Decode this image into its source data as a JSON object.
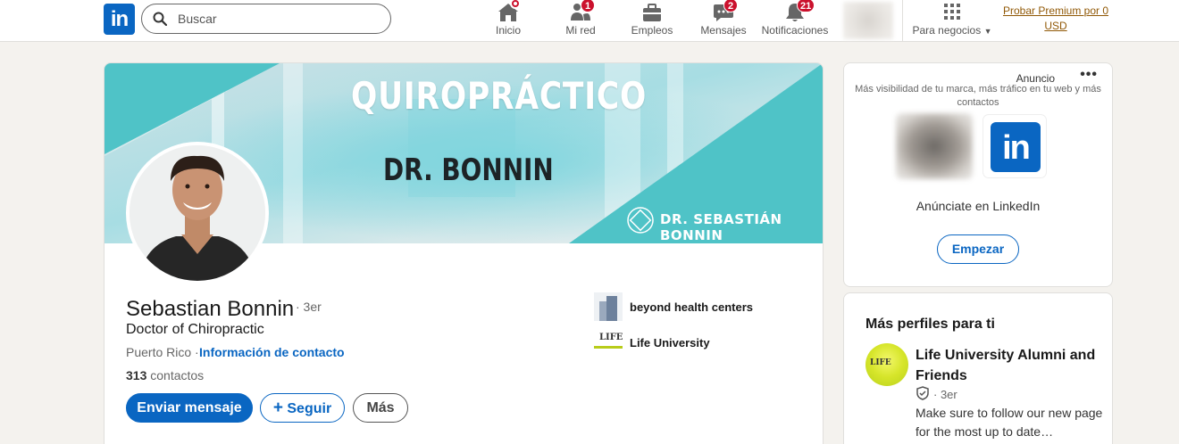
{
  "nav": {
    "logo_text": "in",
    "search_placeholder": "Buscar",
    "items": [
      {
        "label": "Inicio",
        "icon": "home-icon",
        "badge": ""
      },
      {
        "label": "Mi red",
        "icon": "my-network-icon",
        "badge": "1"
      },
      {
        "label": "Empleos",
        "icon": "jobs-icon",
        "badge": ""
      },
      {
        "label": "Mensajes",
        "icon": "messaging-icon",
        "badge": "2"
      },
      {
        "label": "Notificaciones",
        "icon": "bell-icon",
        "badge": "21"
      }
    ],
    "business_label": "Para negocios",
    "premium_label": "Probar Premium por 0 USD"
  },
  "profile": {
    "banner_title": "QUIROPRÁCTICO",
    "banner_subtitle": "DR. BONNIN",
    "banner_brand": "DR. SEBASTIÁN BONNIN",
    "name": "Sebastian Bonnin",
    "degree": "· 3er",
    "headline": "Doctor of Chiropractic",
    "location": "Puerto Rico ·",
    "contact_link": "Información de contacto",
    "connections_count": "313",
    "connections_label": "contactos",
    "message_button": "Enviar mensaje",
    "follow_button": "Seguir",
    "more_button": "Más",
    "experience": [
      {
        "name": "beyond health centers",
        "logo": "company-logo"
      },
      {
        "name": "Life University",
        "logo": "school-logo",
        "logo_text": "LIFE"
      }
    ]
  },
  "ad": {
    "label": "Anuncio",
    "description": "Más visibilidad de tu marca, más tráfico en tu web y más contactos",
    "logo_text": "in",
    "cta_text": "Anúnciate en LinkedIn",
    "button": "Empezar"
  },
  "more_profiles": {
    "title": "Más perfiles para ti",
    "items": [
      {
        "name": "Life University Alumni and Friends",
        "degree": "· 3er",
        "logo_text": "LIFE",
        "description": "Make sure to follow our new page for the most up to date…"
      }
    ]
  },
  "colors": {
    "brand_blue": "#0a66c2",
    "banner_teal": "#4fc3c7",
    "badge_red": "#cb112d",
    "premium_gold": "#915907"
  }
}
